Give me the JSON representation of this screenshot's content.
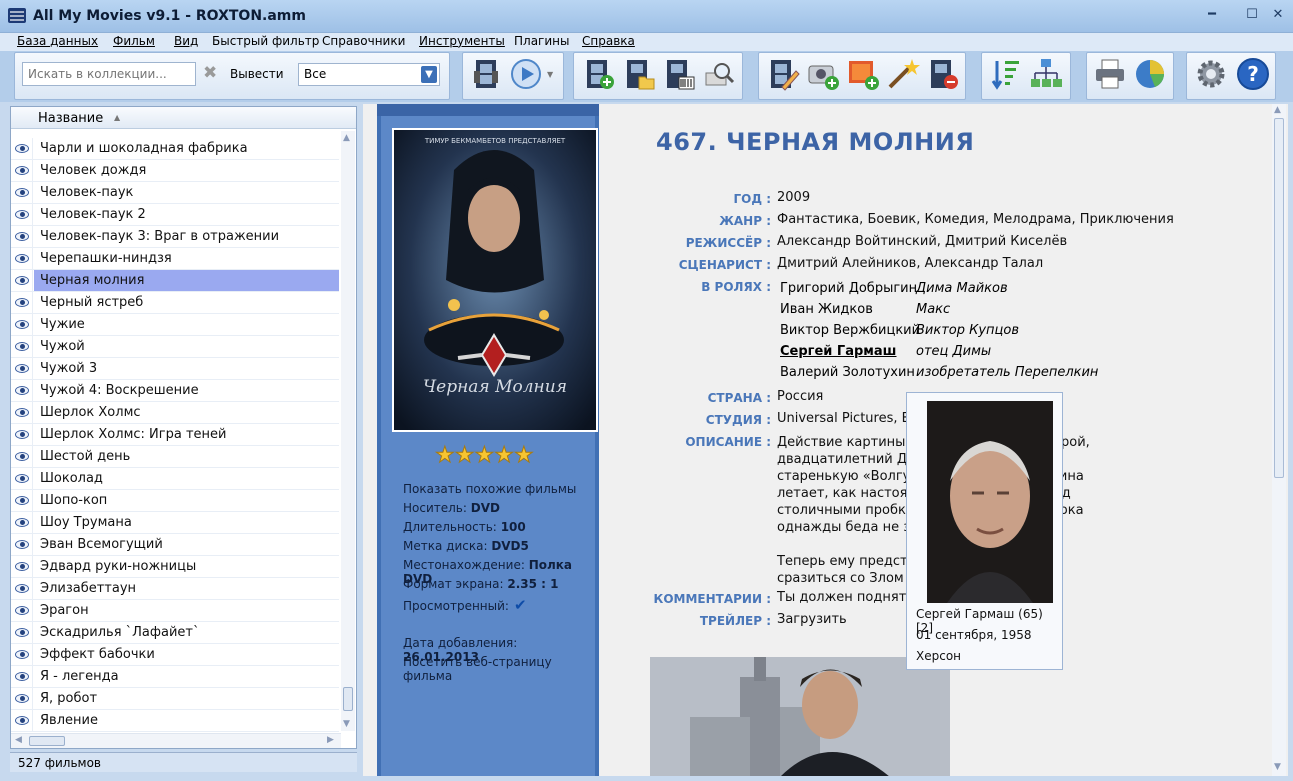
{
  "window": {
    "title": "All My Movies v9.1 - ROXTON.amm"
  },
  "menu": [
    "База данных",
    "Фильм",
    "Вид",
    "Быстрый фильтр",
    "Справочники",
    "Инструменты",
    "Плагины",
    "Справка"
  ],
  "toolbar": {
    "search_placeholder": "Искать в коллекции...",
    "show_label": "Вывести",
    "filter_value": "Все"
  },
  "list": {
    "column_title": "Название",
    "selected_index": 6,
    "items": [
      "Чарли и шоколадная фабрика",
      "Человек дождя",
      "Человек-паук",
      "Человек-паук 2",
      "Человек-паук 3: Враг в отражении",
      "Черепашки-ниндзя",
      "Черная молния",
      "Черный ястреб",
      "Чужие",
      "Чужой",
      "Чужой 3",
      "Чужой 4: Воскрешение",
      "Шерлок Холмс",
      "Шерлок Холмс: Игра теней",
      "Шестой день",
      "Шоколад",
      "Шопо-коп",
      "Шоу Трумана",
      "Эван Всемогущий",
      "Эдвард руки-ножницы",
      "Элизабеттаун",
      "Эрагон",
      "Эскадрилья `Лафайет`",
      "Эффект бабочки",
      "Я - легенда",
      "Я, робот",
      "Явление"
    ],
    "status": "527 фильмов"
  },
  "poster": {
    "top_text": "ТИМУР БЕКМАМБЕТОВ ПРЕДСТАВЛЯЕТ",
    "logo_text": "Черная Молния",
    "rating": 5,
    "similar": "Показать похожие фильмы",
    "media_label": "Носитель:",
    "media": "DVD",
    "length_label": "Длительность:",
    "length": "100",
    "disk_label": "Метка диска:",
    "disk": "DVD5",
    "location_label": "Местонахождение:",
    "location": "Полка DVD",
    "aspect_label": "Формат экрана:",
    "aspect": "2.35 : 1",
    "watched_label": "Просмотренный:",
    "added_label": "Дата добавления:",
    "added": "26.01.2013",
    "website": "Посетить веб-страницу фильма"
  },
  "movie": {
    "number_title": "467.  ЧЕРНАЯ МОЛНИЯ",
    "year_label": "ГОД :",
    "year": "2009",
    "genre_label": "ЖАНР :",
    "genre": "Фантастика, Боевик, Комедия, Мелодрама, Приключения",
    "director_label": "РЕЖИССЁР :",
    "director": "Александр Войтинский, Дмитрий Киселёв",
    "writer_label": "СЦЕНАРИСТ :",
    "writer": "Дмитрий Алейников, Александр Талал",
    "cast_label": "В РОЛЯХ :",
    "cast": [
      {
        "actor": "Григорий Добрыгин",
        "role": "Дима Майков"
      },
      {
        "actor": "Иван Жидков",
        "role": "Макс"
      },
      {
        "actor": "Виктор Вержбицкий",
        "role": "Виктор Купцов"
      },
      {
        "actor": "Сергей Гармаш",
        "role": "отец Димы"
      },
      {
        "actor": "Валерий Золотухин",
        "role": "изобретатель Перепелкин"
      }
    ],
    "country_label": "СТРАНА :",
    "country": "Россия",
    "studio_label": "СТУДИЯ :",
    "studio": "Universal Pictures, Ba",
    "desc_label": "ОПИСАНИЕ :",
    "desc_lines": [
      "Действие картины р                          дни, где главный герой,",
      "двадцатилетний Ди                          подарок от отца",
      "старенькую «Волгу-                         кивает, что его машина",
      "летает, как настоящ                         бесцельно парит над",
      "столичными пробка                          здается полетами, пока",
      "однажды беда не за                          у взглянуть на мир.",
      "",
      "Теперь ему предсто                          к, кем он дорожит, и",
      "сразиться со Злом в                          оскврй."
    ],
    "comments_label": "КОММЕНТАРИИ :",
    "comments": "Ты должен поднять",
    "trailer_label": "ТРЕЙЛЕР :",
    "trailer": "Загрузить"
  },
  "person_popup": {
    "name_line": "Сергей Гармаш (65) [2]",
    "birth_date": "01 сентября, 1958",
    "birth_place": "Херсон"
  }
}
